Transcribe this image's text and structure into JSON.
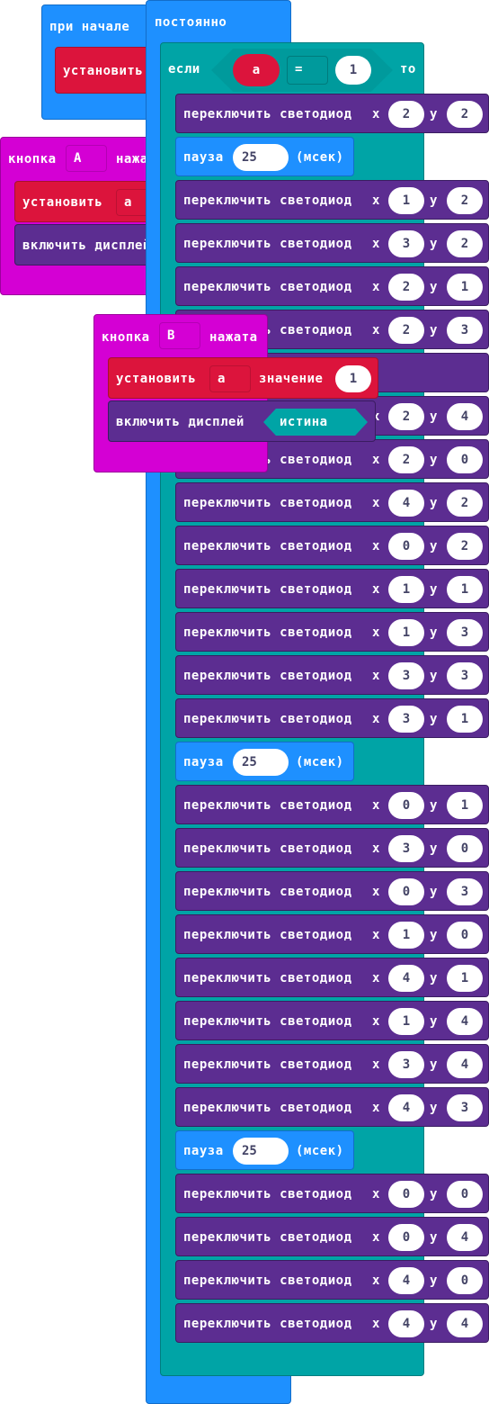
{
  "colors": {
    "loops": "#1e90ff",
    "logic": "#00a4a6",
    "variables": "#dc143c",
    "led": "#5c2d91",
    "input": "#d400d4"
  },
  "on_start": {
    "title": "при начале",
    "set_label": "установить"
  },
  "forever": {
    "title": "постоянно"
  },
  "if_block": {
    "if_label": "если",
    "var": "a",
    "op": "=",
    "value": "1",
    "then_label": "то"
  },
  "toggle_label": "переключить светодиод",
  "x_label": "x",
  "y_label": "y",
  "pause": {
    "label": "пауза",
    "unit": "(мсек)",
    "value": "25"
  },
  "rows": [
    {
      "kind": "toggle",
      "x": "2",
      "y": "2"
    },
    {
      "kind": "pause"
    },
    {
      "kind": "toggle",
      "x": "1",
      "y": "2"
    },
    {
      "kind": "toggle",
      "x": "3",
      "y": "2"
    },
    {
      "kind": "toggle",
      "x": "2",
      "y": "1"
    },
    {
      "kind": "toggle",
      "x": "2",
      "y": "3"
    },
    {
      "kind": "hidden"
    },
    {
      "kind": "toggle",
      "x": "2",
      "y": "4"
    },
    {
      "kind": "toggle",
      "x": "2",
      "y": "0"
    },
    {
      "kind": "toggle",
      "x": "4",
      "y": "2"
    },
    {
      "kind": "toggle",
      "x": "0",
      "y": "2"
    },
    {
      "kind": "toggle",
      "x": "1",
      "y": "1"
    },
    {
      "kind": "toggle",
      "x": "1",
      "y": "3"
    },
    {
      "kind": "toggle",
      "x": "3",
      "y": "3"
    },
    {
      "kind": "toggle",
      "x": "3",
      "y": "1"
    },
    {
      "kind": "pause"
    },
    {
      "kind": "toggle",
      "x": "0",
      "y": "1"
    },
    {
      "kind": "toggle",
      "x": "3",
      "y": "0"
    },
    {
      "kind": "toggle",
      "x": "0",
      "y": "3"
    },
    {
      "kind": "toggle",
      "x": "1",
      "y": "0"
    },
    {
      "kind": "toggle",
      "x": "4",
      "y": "1"
    },
    {
      "kind": "toggle",
      "x": "1",
      "y": "4"
    },
    {
      "kind": "toggle",
      "x": "3",
      "y": "4"
    },
    {
      "kind": "toggle",
      "x": "4",
      "y": "3"
    },
    {
      "kind": "pause"
    },
    {
      "kind": "toggle",
      "x": "0",
      "y": "0"
    },
    {
      "kind": "toggle",
      "x": "0",
      "y": "4"
    },
    {
      "kind": "toggle",
      "x": "4",
      "y": "0"
    },
    {
      "kind": "toggle",
      "x": "4",
      "y": "4"
    }
  ],
  "button_a": {
    "prefix": "кнопка",
    "button": "A",
    "suffix": "нажата",
    "set_label": "установить",
    "var": "a",
    "display_label": "включить дисплей"
  },
  "button_b": {
    "prefix": "кнопка",
    "button": "B",
    "suffix": "нажата",
    "set_label": "установить",
    "var": "a",
    "value_label": "значение",
    "value": "1",
    "display_label": "включить дисплей",
    "display_value": "истина"
  }
}
